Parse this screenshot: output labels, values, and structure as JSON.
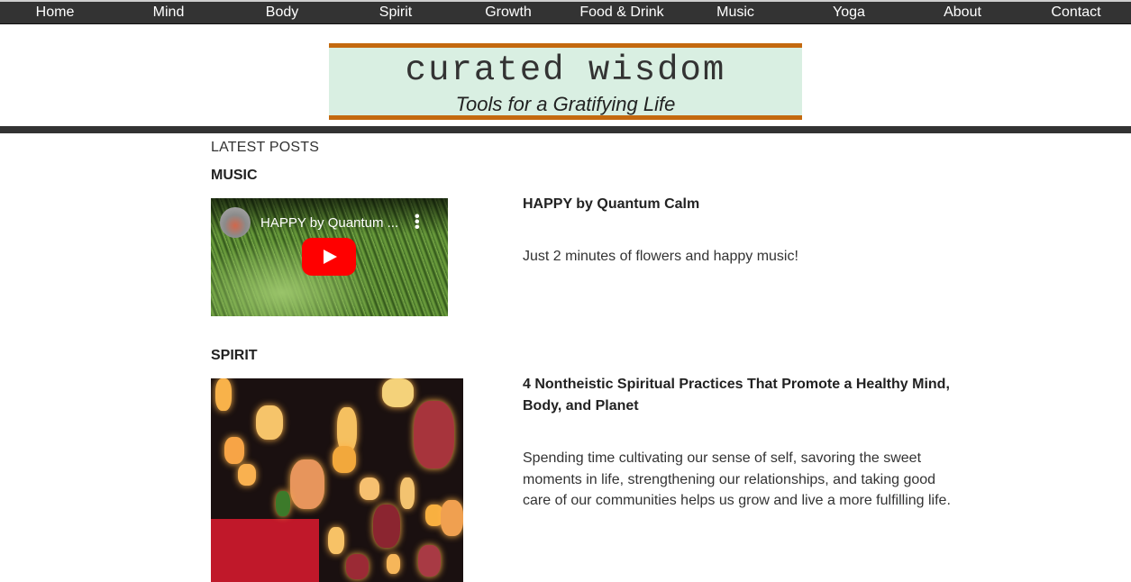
{
  "nav": {
    "items": [
      {
        "label": "Home"
      },
      {
        "label": "Mind"
      },
      {
        "label": "Body"
      },
      {
        "label": "Spirit"
      },
      {
        "label": "Growth"
      },
      {
        "label": "Food & Drink"
      },
      {
        "label": "Music"
      },
      {
        "label": "Yoga"
      },
      {
        "label": "About"
      },
      {
        "label": "Contact"
      }
    ]
  },
  "banner": {
    "title": "curated wisdom",
    "tagline": "Tools for a Gratifying Life",
    "colors": {
      "background": "#d9efe2",
      "border": "#c4690f"
    }
  },
  "main": {
    "section_heading": "LATEST POSTS",
    "posts": [
      {
        "category": "MUSIC",
        "title": "HAPPY by Quantum Calm",
        "excerpt": "Just 2 minutes of flowers and happy music!",
        "media": {
          "type": "youtube-embed",
          "video_title": "HAPPY by Quantum ...",
          "kebab": "⋮",
          "play_icon": "youtube-play-icon"
        }
      },
      {
        "category": "SPIRIT",
        "title": "4 Nontheistic Spiritual Practices That Promote a Healthy Mind, Body, and Planet",
        "excerpt": "Spending time cultivating our sense of self, savoring the sweet moments in life, strengthening our relationships, and taking good care of our communities helps us grow and live a more fulfilling life.",
        "media": {
          "type": "image",
          "subject": "hanging paper lanterns"
        }
      }
    ]
  }
}
